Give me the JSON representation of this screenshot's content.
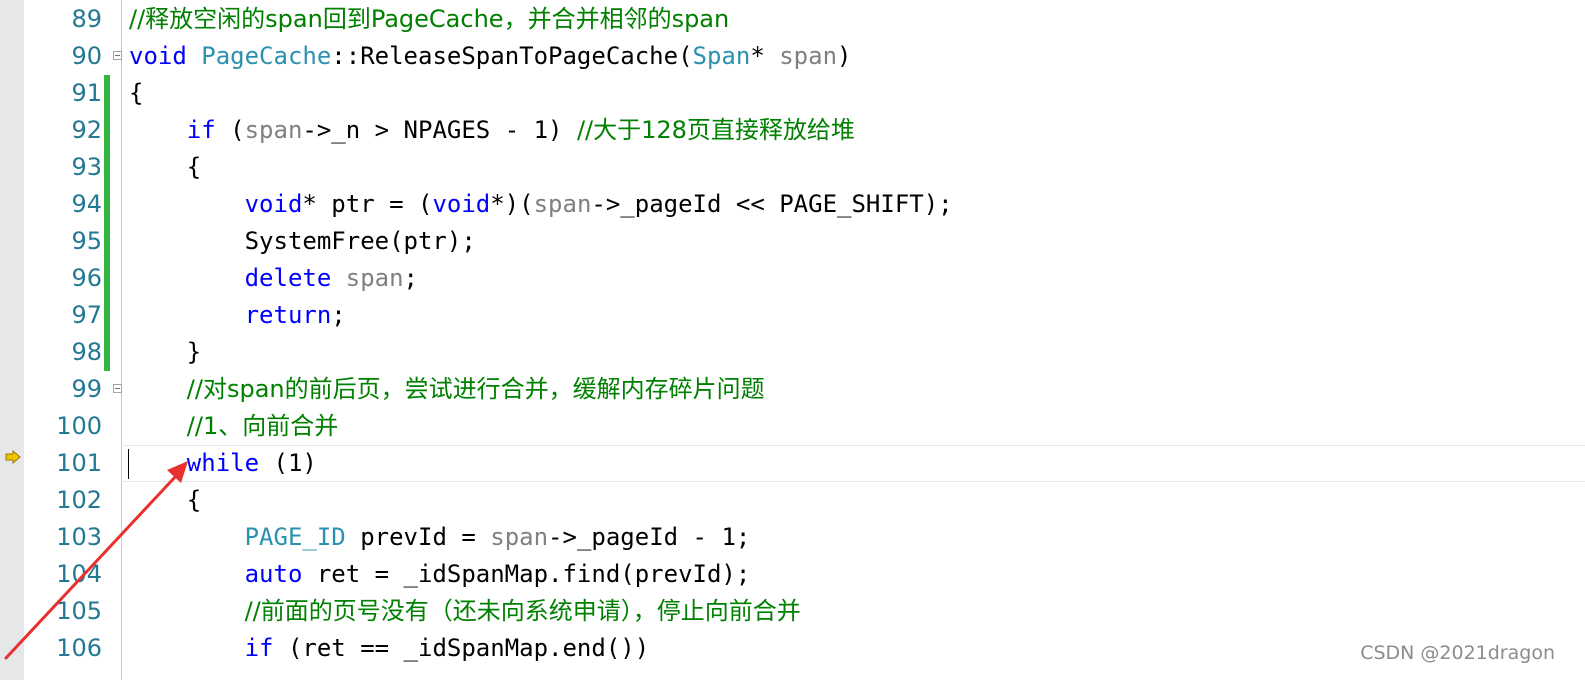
{
  "editor": {
    "current_line": "101",
    "lines": [
      {
        "num": "89",
        "changed": false,
        "fold": false,
        "tokens": [
          {
            "t": "//释放空闲的span回到PageCache，并合并相邻的span",
            "c": "cm"
          }
        ]
      },
      {
        "num": "90",
        "changed": false,
        "fold": true,
        "tokens": [
          {
            "t": "void",
            "c": "kw"
          },
          {
            "t": " ",
            "c": ""
          },
          {
            "t": "PageCache",
            "c": "ty"
          },
          {
            "t": "::ReleaseSpanToPageCache(",
            "c": ""
          },
          {
            "t": "Span",
            "c": "ty"
          },
          {
            "t": "* ",
            "c": ""
          },
          {
            "t": "span",
            "c": "pr"
          },
          {
            "t": ")",
            "c": ""
          }
        ]
      },
      {
        "num": "91",
        "changed": true,
        "fold": false,
        "tokens": [
          {
            "t": "{",
            "c": ""
          }
        ]
      },
      {
        "num": "92",
        "changed": true,
        "fold": false,
        "tokens": [
          {
            "t": "    ",
            "c": ""
          },
          {
            "t": "if",
            "c": "kw"
          },
          {
            "t": " (",
            "c": ""
          },
          {
            "t": "span",
            "c": "pr"
          },
          {
            "t": "->_n > NPAGES - 1) ",
            "c": ""
          },
          {
            "t": "//大于128页直接释放给堆",
            "c": "cm"
          }
        ]
      },
      {
        "num": "93",
        "changed": true,
        "fold": false,
        "tokens": [
          {
            "t": "    {",
            "c": ""
          }
        ]
      },
      {
        "num": "94",
        "changed": true,
        "fold": false,
        "tokens": [
          {
            "t": "        ",
            "c": ""
          },
          {
            "t": "void",
            "c": "kw"
          },
          {
            "t": "* ptr = (",
            "c": ""
          },
          {
            "t": "void",
            "c": "kw"
          },
          {
            "t": "*)(",
            "c": ""
          },
          {
            "t": "span",
            "c": "pr"
          },
          {
            "t": "->_pageId << PAGE_SHIFT);",
            "c": ""
          }
        ]
      },
      {
        "num": "95",
        "changed": true,
        "fold": false,
        "tokens": [
          {
            "t": "        SystemFree(ptr);",
            "c": ""
          }
        ]
      },
      {
        "num": "96",
        "changed": true,
        "fold": false,
        "tokens": [
          {
            "t": "        ",
            "c": ""
          },
          {
            "t": "delete",
            "c": "kw"
          },
          {
            "t": " ",
            "c": ""
          },
          {
            "t": "span",
            "c": "pr"
          },
          {
            "t": ";",
            "c": ""
          }
        ]
      },
      {
        "num": "97",
        "changed": true,
        "fold": false,
        "tokens": [
          {
            "t": "        ",
            "c": ""
          },
          {
            "t": "return",
            "c": "kw"
          },
          {
            "t": ";",
            "c": ""
          }
        ]
      },
      {
        "num": "98",
        "changed": true,
        "fold": false,
        "tokens": [
          {
            "t": "    }",
            "c": ""
          }
        ]
      },
      {
        "num": "99",
        "changed": false,
        "fold": true,
        "tokens": [
          {
            "t": "    ",
            "c": ""
          },
          {
            "t": "//对span的前后页，尝试进行合并，缓解内存碎片问题",
            "c": "cm"
          }
        ]
      },
      {
        "num": "100",
        "changed": false,
        "fold": false,
        "tokens": [
          {
            "t": "    ",
            "c": ""
          },
          {
            "t": "//1、向前合并",
            "c": "cm"
          }
        ]
      },
      {
        "num": "101",
        "changed": false,
        "fold": false,
        "tokens": [
          {
            "t": "    ",
            "c": ""
          },
          {
            "t": "while",
            "c": "kw"
          },
          {
            "t": " (1)",
            "c": ""
          }
        ]
      },
      {
        "num": "102",
        "changed": false,
        "fold": false,
        "tokens": [
          {
            "t": "    {",
            "c": ""
          }
        ]
      },
      {
        "num": "103",
        "changed": false,
        "fold": false,
        "tokens": [
          {
            "t": "        ",
            "c": ""
          },
          {
            "t": "PAGE_ID",
            "c": "ty"
          },
          {
            "t": " prevId = ",
            "c": ""
          },
          {
            "t": "span",
            "c": "pr"
          },
          {
            "t": "->_pageId - 1;",
            "c": ""
          }
        ]
      },
      {
        "num": "104",
        "changed": false,
        "fold": false,
        "tokens": [
          {
            "t": "        ",
            "c": ""
          },
          {
            "t": "auto",
            "c": "kw"
          },
          {
            "t": " ret = _idSpanMap.find(prevId);",
            "c": ""
          }
        ]
      },
      {
        "num": "105",
        "changed": false,
        "fold": false,
        "tokens": [
          {
            "t": "        ",
            "c": ""
          },
          {
            "t": "//前面的页号没有（还未向系统申请），停止向前合并",
            "c": "cm"
          }
        ]
      },
      {
        "num": "106",
        "changed": false,
        "fold": false,
        "tokens": [
          {
            "t": "        ",
            "c": ""
          },
          {
            "t": "if",
            "c": "kw"
          },
          {
            "t": " (ret == _idSpanMap.end())",
            "c": ""
          }
        ]
      }
    ]
  },
  "icons": {
    "execution_pointer": "execution-arrow-icon",
    "fold_toggle": "collapse-box-icon"
  },
  "colors": {
    "keyword": "#0000ff",
    "type": "#2b91af",
    "comment": "#008000",
    "parameter": "#808080",
    "line_number": "#237893",
    "change_bar": "#33b542",
    "annotation_arrow": "#e8302f",
    "execution_arrow": "#f2c300"
  },
  "watermark": "CSDN @2021dragon"
}
